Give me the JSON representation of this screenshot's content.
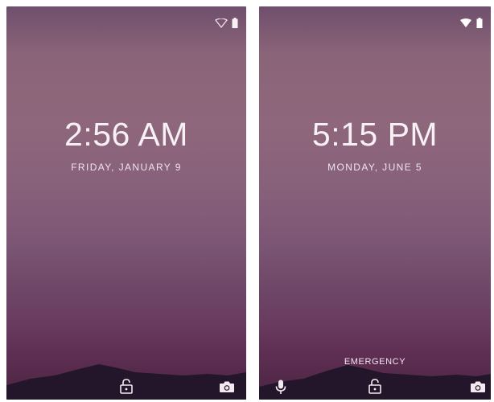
{
  "screens": [
    {
      "time": "2:56 AM",
      "date": "FRIDAY, JANUARY 9",
      "wifi_filled": false,
      "icons": [
        "wifi-outline-icon",
        "battery-icon",
        "lock-icon",
        "camera-icon"
      ]
    },
    {
      "time": "5:15 PM",
      "date": "MONDAY, JUNE 5",
      "wifi_filled": true,
      "emergency_label": "EMERGENCY",
      "icons": [
        "wifi-icon",
        "battery-icon",
        "microphone-icon",
        "lock-icon",
        "camera-icon"
      ]
    }
  ],
  "colors": {
    "wallpaper_top": "#8a6478",
    "wallpaper_bottom": "#4a2442",
    "text": "#f7f1f5"
  }
}
